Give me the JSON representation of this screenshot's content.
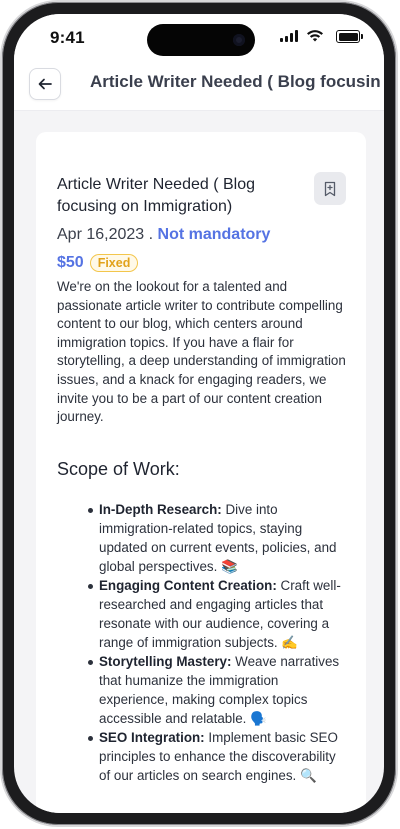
{
  "status_bar": {
    "time": "9:41"
  },
  "header": {
    "title": "Article Writer Needed ( Blog focusing on Immigration)"
  },
  "job": {
    "title": "Article Writer Needed ( Blog focusing on Immigration)",
    "date": "Apr 16,2023",
    "separator": " . ",
    "mandatory": "Not mandatory",
    "price": "$50",
    "price_type": "Fixed",
    "description": "We're on the lookout for a talented and passionate article writer to contribute compelling content to our blog, which centers around immigration topics. If you have a flair for storytelling, a deep understanding of immigration issues, and a knack for engaging readers, we invite you to be a part of our content creation journey."
  },
  "scope": {
    "title": "Scope of Work:",
    "items": [
      {
        "label": "In-Depth Research:",
        "text": " Dive into immigration-related topics, staying updated on current events, policies, and global perspectives. 📚"
      },
      {
        "label": "Engaging Content Creation:",
        "text": " Craft well-researched and engaging articles that resonate with our audience, covering a range of immigration subjects. ✍️"
      },
      {
        "label": "Storytelling Mastery:",
        "text": " Weave narratives that humanize the immigration experience, making complex topics accessible and relatable. 🗣️"
      },
      {
        "label": "SEO Integration:",
        "text": " Implement basic SEO principles to enhance the discoverability of our articles on search engines. 🔍"
      }
    ]
  },
  "icons": {
    "back": "arrow-left-icon",
    "bookmark": "bookmark-add-icon",
    "signal": "cellular-signal-icon",
    "wifi": "wifi-icon",
    "battery": "battery-icon"
  },
  "colors": {
    "accent": "#5573e3",
    "badge": "#e2a21a",
    "background": "#f4f4f6"
  }
}
